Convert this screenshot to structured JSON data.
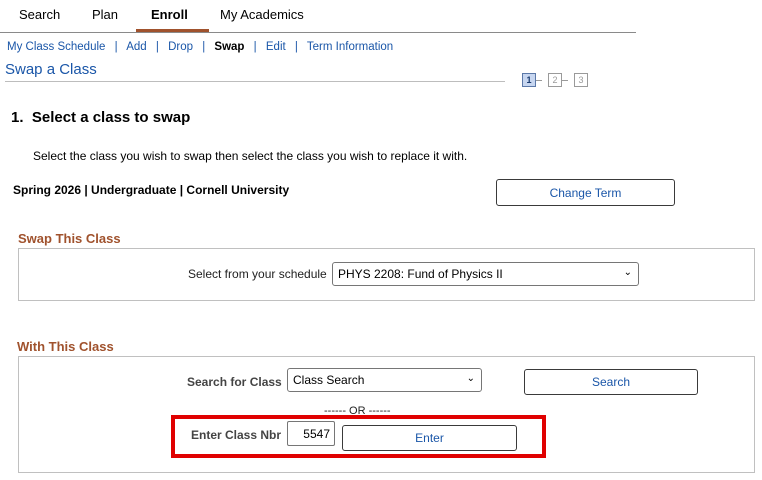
{
  "tabs": [
    {
      "label": "Search"
    },
    {
      "label": "Plan"
    },
    {
      "label": "Enroll"
    },
    {
      "label": "My Academics"
    }
  ],
  "subnav": {
    "my_class_schedule": "My Class Schedule",
    "add": "Add",
    "drop": "Drop",
    "swap": "Swap",
    "edit": "Edit",
    "term_information": "Term Information",
    "separator": "|"
  },
  "page_title": "Swap a Class",
  "steps": [
    "1",
    "2",
    "3"
  ],
  "step_heading": "1.  Select a class to swap",
  "instructions": "Select the class you wish to swap then select the class you wish to replace it with.",
  "term_info": "Spring 2026 | Undergraduate | Cornell University",
  "change_term_label": "Change Term",
  "swap_section": {
    "title": "Swap This Class",
    "select_label": "Select from your schedule",
    "selected_value": "PHYS 2208: Fund of Physics II"
  },
  "with_section": {
    "title": "With This Class",
    "search_label": "Search for Class",
    "search_select_value": "Class Search",
    "search_button": "Search",
    "or_text": "------ OR ------",
    "class_nbr_label": "Enter Class Nbr",
    "class_nbr_value": "5547",
    "enter_button": "Enter"
  },
  "colors": {
    "accent_brown": "#a0522d",
    "link_blue": "#1a56a8",
    "highlight_red": "#e00000"
  },
  "icons": {
    "dropdown": "chevron-down-icon"
  }
}
